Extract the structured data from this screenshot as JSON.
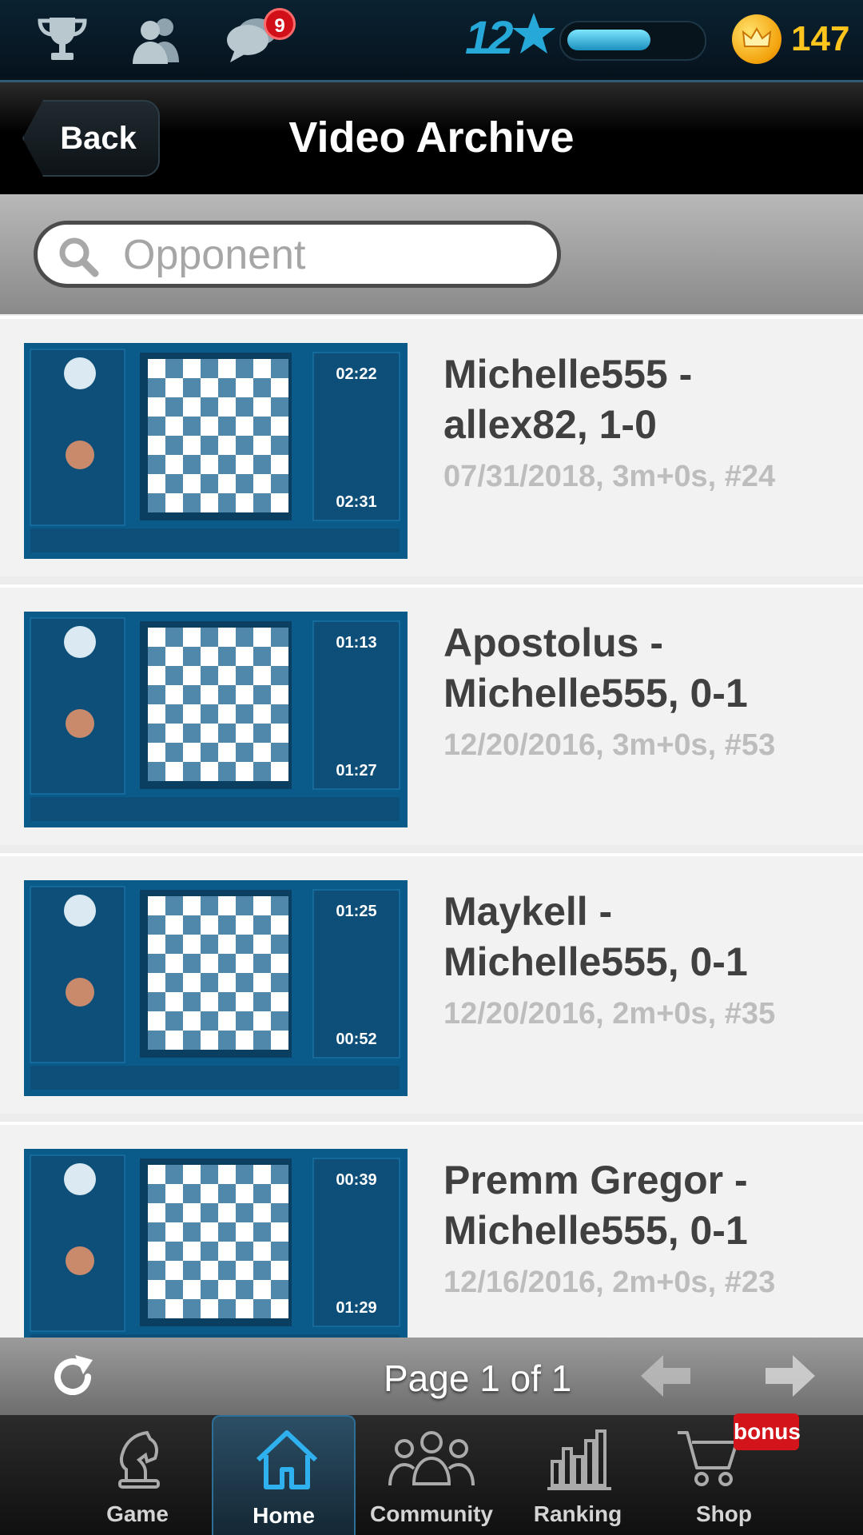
{
  "status_bar": {
    "trophy_icon": "trophy-icon",
    "friends_icon": "friends-icon",
    "chat_icon": "chat-icon",
    "chat_badge": "9",
    "level": "12",
    "level_icon": "star-icon",
    "xp_progress": 0.65,
    "coin_icon": "crown-coin-icon",
    "coins": "147"
  },
  "header": {
    "back_label": "Back",
    "title": "Video Archive"
  },
  "search": {
    "placeholder": "Opponent",
    "value": ""
  },
  "videos": [
    {
      "title_line1": "Michelle555 -",
      "title_line2": "allex82, 1-0",
      "meta": "07/31/2018, 3m+0s, #24",
      "clock_top": "02:22",
      "clock_bottom": "02:31"
    },
    {
      "title_line1": "Apostolus -",
      "title_line2": "Michelle555, 0-1",
      "meta": "12/20/2016, 3m+0s, #53",
      "clock_top": "01:13",
      "clock_bottom": "01:27"
    },
    {
      "title_line1": "Maykell -",
      "title_line2": "Michelle555, 0-1",
      "meta": "12/20/2016, 2m+0s, #35",
      "clock_top": "01:25",
      "clock_bottom": "00:52"
    },
    {
      "title_line1": "Premm Gregor -",
      "title_line2": "Michelle555, 0-1",
      "meta": "12/16/2016, 2m+0s, #23",
      "clock_top": "00:39",
      "clock_bottom": "01:29"
    }
  ],
  "pager": {
    "label": "Page 1 of 1",
    "refresh_icon": "refresh-icon",
    "prev_icon": "arrow-left-icon",
    "next_icon": "arrow-right-icon"
  },
  "nav": {
    "items": [
      {
        "label": "Game",
        "icon": "chess-knight-icon"
      },
      {
        "label": "Home",
        "icon": "home-icon",
        "active": true
      },
      {
        "label": "Community",
        "icon": "community-icon"
      },
      {
        "label": "Ranking",
        "icon": "ranking-icon"
      },
      {
        "label": "Shop",
        "icon": "cart-icon"
      }
    ],
    "bonus_label": "bonus"
  },
  "colors": {
    "accent_blue": "#26a9d8",
    "coin_gold": "#ffc51c",
    "badge_red": "#d10f18",
    "thumb_blue": "#0a5a8a"
  }
}
